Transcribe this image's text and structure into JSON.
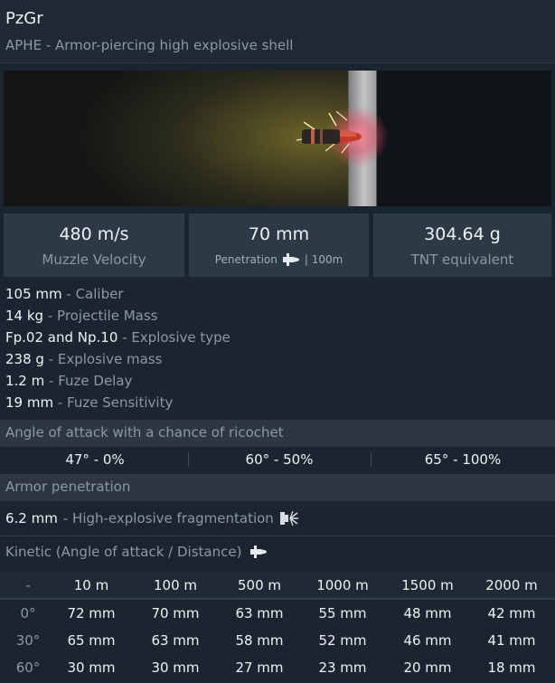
{
  "header": {
    "title": "PzGr",
    "subtitle": "APHE - Armor-piercing high explosive shell"
  },
  "preview": {
    "icon": "shell-impact-preview"
  },
  "stats": {
    "velocity": {
      "value": "480 m/s",
      "label": "Muzzle Velocity"
    },
    "penetration": {
      "value": "70 mm",
      "label": "Penetration",
      "range": "| 100m",
      "icon": "shell-icon"
    },
    "tnt": {
      "value": "304.64 g",
      "label": "TNT equivalent"
    }
  },
  "specs": [
    {
      "value": "105 mm",
      "label": "- Caliber"
    },
    {
      "value": "14 kg",
      "label": "- Projectile Mass"
    },
    {
      "value": "Fp.02 and Np.10",
      "label": "- Explosive type"
    },
    {
      "value": "238 g",
      "label": "- Explosive mass"
    },
    {
      "value": "1.2 m",
      "label": "- Fuze Delay"
    },
    {
      "value": "19 mm",
      "label": "- Fuze Sensitivity"
    }
  ],
  "ricochet": {
    "title": "Angle of attack with a chance of ricochet",
    "values": [
      {
        "angle": "47°",
        "chance": "- 0%"
      },
      {
        "angle": "60°",
        "chance": "- 50%"
      },
      {
        "angle": "65°",
        "chance": "- 100%"
      }
    ]
  },
  "armor": {
    "title": "Armor penetration",
    "he_value": "6.2 mm",
    "he_label": "- High-explosive fragmentation",
    "he_icon": "fragmentation-icon"
  },
  "kinetic": {
    "title": "Kinetic (Angle of attack / Distance)",
    "icon": "shell-icon",
    "corner": "-",
    "distances": [
      "10 m",
      "100 m",
      "500 m",
      "1000 m",
      "1500 m",
      "2000 m"
    ],
    "rows": [
      {
        "angle": "0°",
        "values": [
          "72 mm",
          "70 mm",
          "63 mm",
          "55 mm",
          "48 mm",
          "42 mm"
        ]
      },
      {
        "angle": "30°",
        "values": [
          "65 mm",
          "63 mm",
          "58 mm",
          "52 mm",
          "46 mm",
          "41 mm"
        ]
      },
      {
        "angle": "60°",
        "values": [
          "30 mm",
          "30 mm",
          "27 mm",
          "23 mm",
          "20 mm",
          "18 mm"
        ]
      }
    ]
  }
}
